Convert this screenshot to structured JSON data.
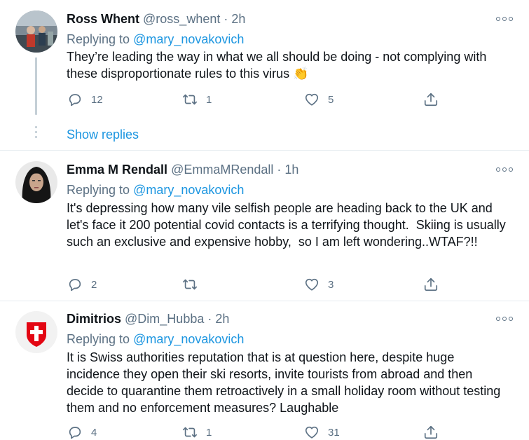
{
  "tweets": [
    {
      "name": "Ross Whent",
      "handle": "@ross_whent",
      "sep": "·",
      "time": "2h",
      "replying_label": "Replying to",
      "replying_to": "@mary_novakovich",
      "text": "They’re leading the way in what we all should be doing - not complying with these disproportionate rules to this virus",
      "emoji": "👏",
      "replies": "12",
      "retweets": "1",
      "likes": "5",
      "show_replies": "Show replies"
    },
    {
      "name": "Emma M Rendall",
      "handle": "@EmmaMRendall",
      "sep": "·",
      "time": "1h",
      "replying_label": "Replying to",
      "replying_to": "@mary_novakovich",
      "text": "It's depressing how many vile selfish people are heading back to the UK and let's face it 200 potential covid contacts is a terrifying thought.  Skiing is usually such an exclusive and expensive hobby,  so I am left wondering..WTAF?!!",
      "replies": "2",
      "retweets": "",
      "likes": "3"
    },
    {
      "name": "Dimitrios",
      "handle": "@Dim_Hubba",
      "sep": "·",
      "time": "2h",
      "replying_label": "Replying to",
      "replying_to": "@mary_novakovich",
      "text": "It is Swiss authorities reputation that is at question here, despite huge incidence they open their ski resorts, invite tourists from abroad and then decide to quarantine them retroactively in a small holiday room without testing them and no enforcement measures? Laughable",
      "replies": "4",
      "retweets": "1",
      "likes": "31"
    }
  ],
  "icons": {
    "reply": "reply-icon",
    "retweet": "retweet-icon",
    "like": "like-icon",
    "share": "share-icon",
    "more": "more-icon"
  },
  "colors": {
    "link": "#1b95e0",
    "secondary": "#5b7083",
    "divider": "#e6ecf0"
  }
}
